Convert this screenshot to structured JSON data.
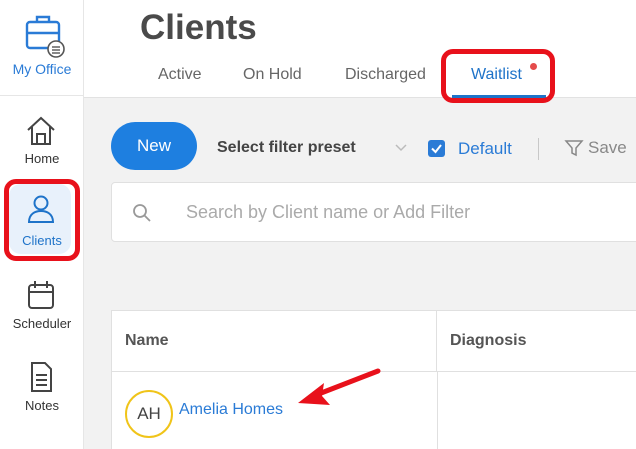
{
  "app": {
    "brand_label": "My Office"
  },
  "sidebar": {
    "items": [
      {
        "label": "Home",
        "icon": "home-icon"
      },
      {
        "label": "Clients",
        "icon": "person-icon",
        "active": true
      },
      {
        "label": "Scheduler",
        "icon": "calendar-icon"
      },
      {
        "label": "Notes",
        "icon": "document-icon"
      }
    ]
  },
  "header": {
    "title": "Clients",
    "tabs": [
      {
        "label": "Active"
      },
      {
        "label": "On Hold"
      },
      {
        "label": "Discharged"
      },
      {
        "label": "Waitlist",
        "selected": true
      }
    ]
  },
  "toolbar": {
    "new_label": "New",
    "filter_preset_label": "Select filter preset",
    "default_label": "Default",
    "default_checked": true,
    "save_label": "Save"
  },
  "search": {
    "placeholder": "Search by Client name or Add Filter",
    "value": ""
  },
  "table": {
    "columns": [
      "Name",
      "Diagnosis"
    ],
    "rows": [
      {
        "initials": "AH",
        "name": "Amelia Homes",
        "diagnosis": ""
      }
    ]
  },
  "colors": {
    "accent": "#1e7fe0",
    "highlight": "#e8111b",
    "avatar_ring": "#f0c419"
  }
}
